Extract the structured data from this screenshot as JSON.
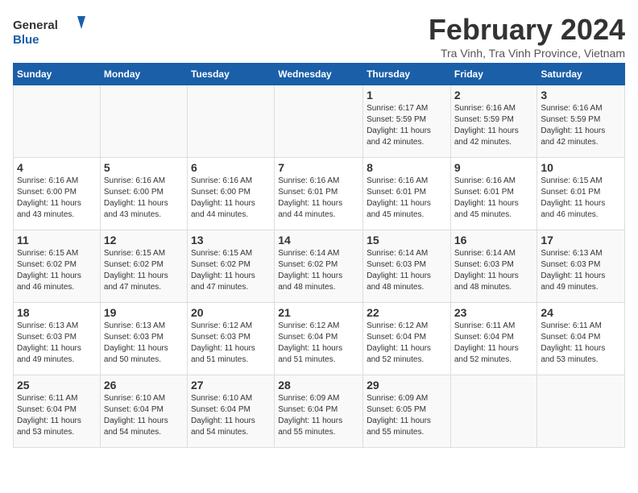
{
  "logo": {
    "text_general": "General",
    "text_blue": "Blue"
  },
  "header": {
    "title": "February 2024",
    "subtitle": "Tra Vinh, Tra Vinh Province, Vietnam"
  },
  "weekdays": [
    "Sunday",
    "Monday",
    "Tuesday",
    "Wednesday",
    "Thursday",
    "Friday",
    "Saturday"
  ],
  "weeks": [
    [
      {
        "day": "",
        "info": ""
      },
      {
        "day": "",
        "info": ""
      },
      {
        "day": "",
        "info": ""
      },
      {
        "day": "",
        "info": ""
      },
      {
        "day": "1",
        "info": "Sunrise: 6:17 AM\nSunset: 5:59 PM\nDaylight: 11 hours\nand 42 minutes."
      },
      {
        "day": "2",
        "info": "Sunrise: 6:16 AM\nSunset: 5:59 PM\nDaylight: 11 hours\nand 42 minutes."
      },
      {
        "day": "3",
        "info": "Sunrise: 6:16 AM\nSunset: 5:59 PM\nDaylight: 11 hours\nand 42 minutes."
      }
    ],
    [
      {
        "day": "4",
        "info": "Sunrise: 6:16 AM\nSunset: 6:00 PM\nDaylight: 11 hours\nand 43 minutes."
      },
      {
        "day": "5",
        "info": "Sunrise: 6:16 AM\nSunset: 6:00 PM\nDaylight: 11 hours\nand 43 minutes."
      },
      {
        "day": "6",
        "info": "Sunrise: 6:16 AM\nSunset: 6:00 PM\nDaylight: 11 hours\nand 44 minutes."
      },
      {
        "day": "7",
        "info": "Sunrise: 6:16 AM\nSunset: 6:01 PM\nDaylight: 11 hours\nand 44 minutes."
      },
      {
        "day": "8",
        "info": "Sunrise: 6:16 AM\nSunset: 6:01 PM\nDaylight: 11 hours\nand 45 minutes."
      },
      {
        "day": "9",
        "info": "Sunrise: 6:16 AM\nSunset: 6:01 PM\nDaylight: 11 hours\nand 45 minutes."
      },
      {
        "day": "10",
        "info": "Sunrise: 6:15 AM\nSunset: 6:01 PM\nDaylight: 11 hours\nand 46 minutes."
      }
    ],
    [
      {
        "day": "11",
        "info": "Sunrise: 6:15 AM\nSunset: 6:02 PM\nDaylight: 11 hours\nand 46 minutes."
      },
      {
        "day": "12",
        "info": "Sunrise: 6:15 AM\nSunset: 6:02 PM\nDaylight: 11 hours\nand 47 minutes."
      },
      {
        "day": "13",
        "info": "Sunrise: 6:15 AM\nSunset: 6:02 PM\nDaylight: 11 hours\nand 47 minutes."
      },
      {
        "day": "14",
        "info": "Sunrise: 6:14 AM\nSunset: 6:02 PM\nDaylight: 11 hours\nand 48 minutes."
      },
      {
        "day": "15",
        "info": "Sunrise: 6:14 AM\nSunset: 6:03 PM\nDaylight: 11 hours\nand 48 minutes."
      },
      {
        "day": "16",
        "info": "Sunrise: 6:14 AM\nSunset: 6:03 PM\nDaylight: 11 hours\nand 48 minutes."
      },
      {
        "day": "17",
        "info": "Sunrise: 6:13 AM\nSunset: 6:03 PM\nDaylight: 11 hours\nand 49 minutes."
      }
    ],
    [
      {
        "day": "18",
        "info": "Sunrise: 6:13 AM\nSunset: 6:03 PM\nDaylight: 11 hours\nand 49 minutes."
      },
      {
        "day": "19",
        "info": "Sunrise: 6:13 AM\nSunset: 6:03 PM\nDaylight: 11 hours\nand 50 minutes."
      },
      {
        "day": "20",
        "info": "Sunrise: 6:12 AM\nSunset: 6:03 PM\nDaylight: 11 hours\nand 51 minutes."
      },
      {
        "day": "21",
        "info": "Sunrise: 6:12 AM\nSunset: 6:04 PM\nDaylight: 11 hours\nand 51 minutes."
      },
      {
        "day": "22",
        "info": "Sunrise: 6:12 AM\nSunset: 6:04 PM\nDaylight: 11 hours\nand 52 minutes."
      },
      {
        "day": "23",
        "info": "Sunrise: 6:11 AM\nSunset: 6:04 PM\nDaylight: 11 hours\nand 52 minutes."
      },
      {
        "day": "24",
        "info": "Sunrise: 6:11 AM\nSunset: 6:04 PM\nDaylight: 11 hours\nand 53 minutes."
      }
    ],
    [
      {
        "day": "25",
        "info": "Sunrise: 6:11 AM\nSunset: 6:04 PM\nDaylight: 11 hours\nand 53 minutes."
      },
      {
        "day": "26",
        "info": "Sunrise: 6:10 AM\nSunset: 6:04 PM\nDaylight: 11 hours\nand 54 minutes."
      },
      {
        "day": "27",
        "info": "Sunrise: 6:10 AM\nSunset: 6:04 PM\nDaylight: 11 hours\nand 54 minutes."
      },
      {
        "day": "28",
        "info": "Sunrise: 6:09 AM\nSunset: 6:04 PM\nDaylight: 11 hours\nand 55 minutes."
      },
      {
        "day": "29",
        "info": "Sunrise: 6:09 AM\nSunset: 6:05 PM\nDaylight: 11 hours\nand 55 minutes."
      },
      {
        "day": "",
        "info": ""
      },
      {
        "day": "",
        "info": ""
      }
    ]
  ]
}
